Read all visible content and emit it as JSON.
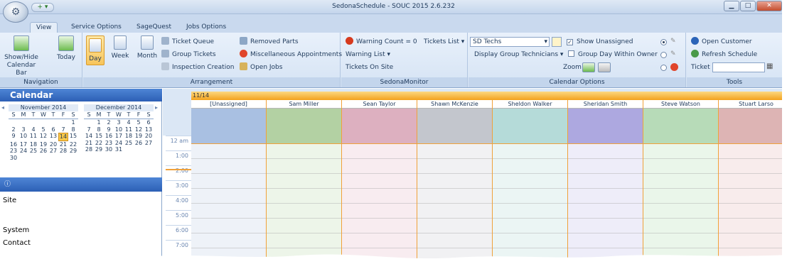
{
  "window": {
    "title": "SedonaSchedule - SOUC 2015 2.6.232",
    "qat_glyph": "+ ▾",
    "controls": {
      "minimize": "▁",
      "maximize": "□",
      "close": "✕"
    }
  },
  "tabs": [
    {
      "label": "View",
      "active": true
    },
    {
      "label": "Service Options",
      "active": false
    },
    {
      "label": "SageQuest",
      "active": false
    },
    {
      "label": "Jobs Options",
      "active": false
    }
  ],
  "ribbon": {
    "navigation": {
      "caption": "Navigation",
      "show_hide": "Show/Hide Calendar Bar",
      "today": "Today"
    },
    "arrangement": {
      "caption": "Arrangement",
      "day": "Day",
      "week": "Week",
      "month": "Month",
      "ticket_queue": "Ticket Queue",
      "group_tickets": "Group Tickets",
      "inspection_creation": "Inspection Creation",
      "removed_parts": "Removed Parts",
      "misc_appointments": "Miscellaneous Appointments",
      "open_jobs": "Open Jobs"
    },
    "sedona_monitor": {
      "caption": "SedonaMonitor",
      "warning_count": "Warning Count = 0",
      "tickets_list": "Tickets List",
      "warning_list": "Warning List",
      "tickets_on_site": "Tickets On Site"
    },
    "calendar_options": {
      "caption": "Calendar Options",
      "tech_combo": "SD Techs",
      "show_unassigned": "Show Unassigned",
      "show_unassigned_checked": true,
      "display_group_technicians": "Display Group Technicians",
      "group_day_within_owner": "Group Day Within Owner",
      "zoom": "Zoom"
    },
    "tools": {
      "caption": "Tools",
      "open_customer": "Open Customer",
      "refresh_schedule": "Refresh Schedule",
      "ticket_label": "Ticket",
      "ticket_value": ""
    }
  },
  "calendar": {
    "header": "Calendar",
    "months": [
      {
        "title": "November 2014",
        "dow": [
          "S",
          "M",
          "T",
          "W",
          "T",
          "F",
          "S"
        ],
        "weeks": [
          [
            "",
            "",
            "",
            "",
            "",
            "",
            "1"
          ],
          [
            "2",
            "3",
            "4",
            "5",
            "6",
            "7",
            "8"
          ],
          [
            "9",
            "10",
            "11",
            "12",
            "13",
            "14",
            "15"
          ],
          [
            "16",
            "17",
            "18",
            "19",
            "20",
            "21",
            "22"
          ],
          [
            "23",
            "24",
            "25",
            "26",
            "27",
            "28",
            "29"
          ],
          [
            "30",
            "",
            "",
            "",
            "",
            "",
            ""
          ]
        ],
        "today": "14"
      },
      {
        "title": "December 2014",
        "dow": [
          "S",
          "M",
          "T",
          "W",
          "T",
          "F",
          "S"
        ],
        "weeks": [
          [
            "",
            "1",
            "2",
            "3",
            "4",
            "5",
            "6"
          ],
          [
            "7",
            "8",
            "9",
            "10",
            "11",
            "12",
            "13"
          ],
          [
            "14",
            "15",
            "16",
            "17",
            "18",
            "19",
            "20"
          ],
          [
            "21",
            "22",
            "23",
            "24",
            "25",
            "26",
            "27"
          ],
          [
            "28",
            "29",
            "30",
            "31",
            "",
            "",
            ""
          ]
        ]
      }
    ],
    "nav_prev": "◂",
    "nav_next": "▸"
  },
  "info_panel": {
    "site_label": "Site",
    "system_label": "System",
    "contact_label": "Contact"
  },
  "schedule": {
    "date": "11/14",
    "columns": [
      {
        "name": "[Unassigned]",
        "color": "#a9c0e2",
        "body": "#eef2f8"
      },
      {
        "name": "Sam Miller",
        "color": "#b3d1a3",
        "body": "#edf5e9"
      },
      {
        "name": "Sean Taylor",
        "color": "#ddb0c0",
        "body": "#f8ecf0"
      },
      {
        "name": "Shawn McKenzie",
        "color": "#c3c6cd",
        "body": "#f1f1f3"
      },
      {
        "name": "Sheldon Walker",
        "color": "#b5dbd9",
        "body": "#ebf5f4"
      },
      {
        "name": "Sheridan Smith",
        "color": "#ada8e0",
        "body": "#eeedf9"
      },
      {
        "name": "Steve Watson",
        "color": "#b7dbb8",
        "body": "#eaf6ea"
      },
      {
        "name": "Stuart Larso",
        "color": "#ddb4b4",
        "body": "#f8ecec"
      }
    ],
    "times": [
      "12 am",
      "1:00",
      "2:00",
      "3:00",
      "4:00",
      "5:00",
      "6:00",
      "7:00"
    ]
  }
}
